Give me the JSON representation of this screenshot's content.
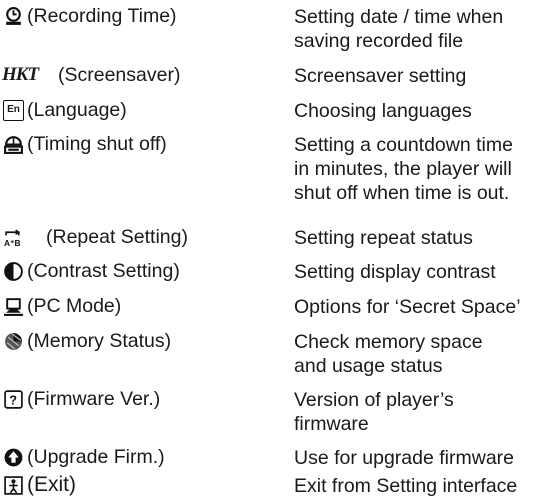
{
  "settings": [
    {
      "icon": "recording-time-clock-icon",
      "label": "(Recording Time)",
      "desc": [
        "Setting date / time when",
        "saving recorded file"
      ]
    },
    {
      "icon": "screensaver-text-icon",
      "icon_text": "HKT",
      "label": "(Screensaver)",
      "desc": [
        "Screensaver setting"
      ]
    },
    {
      "icon": "language-icon",
      "icon_text": "En",
      "label": "(Language)",
      "desc": [
        "Choosing languages"
      ]
    },
    {
      "icon": "timing-shutoff-icon",
      "label": "(Timing shut off)",
      "desc": [
        "Setting a countdown time",
        "in minutes, the player will",
        "shut off when time is out."
      ]
    },
    {
      "icon": "repeat-ab-icon",
      "label": "(Repeat Setting)",
      "desc": [
        "Setting repeat status"
      ]
    },
    {
      "icon": "contrast-icon",
      "label": "(Contrast Setting)",
      "desc": [
        "Setting display contrast"
      ]
    },
    {
      "icon": "pc-mode-icon",
      "label": "(PC Mode)",
      "desc": [
        "Options for ‘Secret Space’"
      ]
    },
    {
      "icon": "memory-status-icon",
      "label": "(Memory Status)",
      "desc": [
        "Check memory space",
        "and usage status"
      ]
    },
    {
      "icon": "firmware-version-icon",
      "label": "(Firmware Ver.)",
      "desc": [
        "Version of player’s",
        "firmware"
      ]
    },
    {
      "icon": "upgrade-firmware-icon",
      "label": "(Upgrade Firm.)",
      "desc": [
        "Use for upgrade firmware"
      ]
    },
    {
      "icon": "exit-icon",
      "label": "(Exit)",
      "desc": [
        "Exit from Setting interface"
      ]
    }
  ]
}
